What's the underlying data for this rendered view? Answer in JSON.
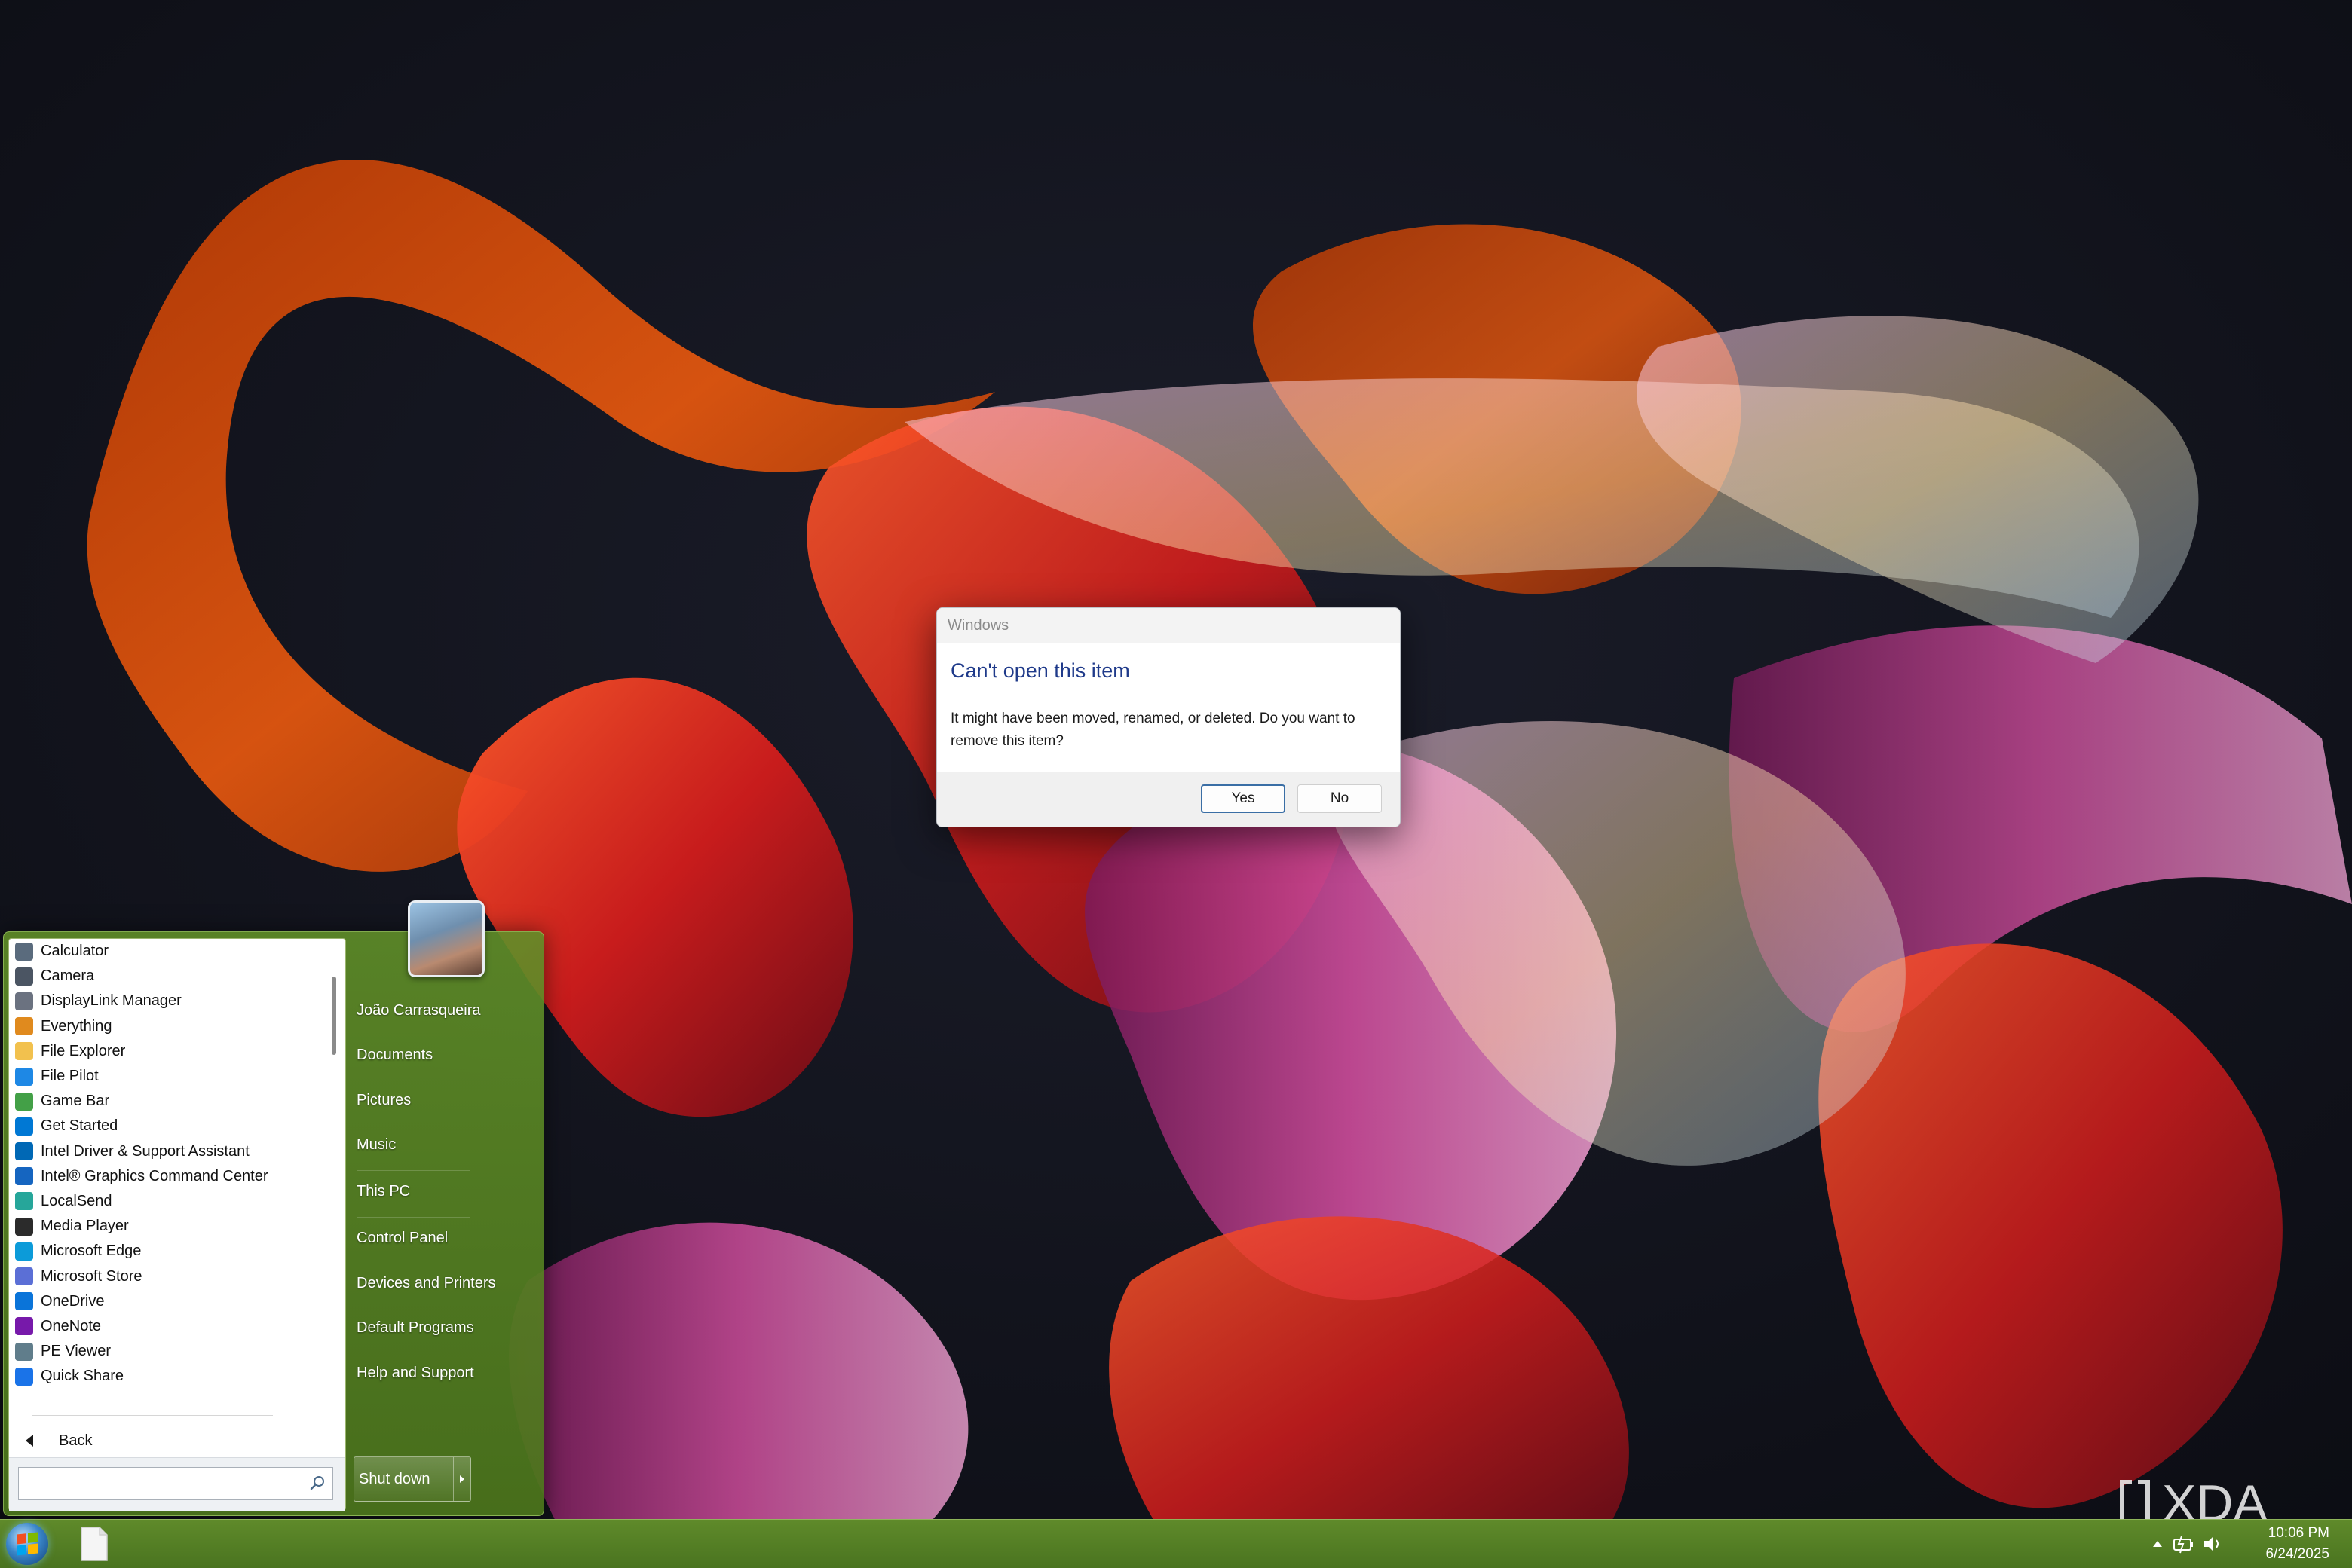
{
  "dialog": {
    "title": "Windows",
    "heading": "Can't open this item",
    "message": "It might have been moved, renamed, or deleted. Do you want to remove this item?",
    "yes_label": "Yes",
    "no_label": "No"
  },
  "start_menu": {
    "programs": [
      {
        "label": "Calculator",
        "icon": "calculator-icon",
        "color": "#5a6b7d"
      },
      {
        "label": "Camera",
        "icon": "camera-icon",
        "color": "#4b5563"
      },
      {
        "label": "DisplayLink Manager",
        "icon": "displaylink-icon",
        "color": "#6b7280"
      },
      {
        "label": "Everything",
        "icon": "everything-icon",
        "color": "#e08a1e"
      },
      {
        "label": "File Explorer",
        "icon": "folder-icon",
        "color": "#f2c14e"
      },
      {
        "label": "File Pilot",
        "icon": "file-pilot-icon",
        "color": "#1e88e5"
      },
      {
        "label": "Game Bar",
        "icon": "game-bar-icon",
        "color": "#43a047"
      },
      {
        "label": "Get Started",
        "icon": "get-started-icon",
        "color": "#0078d4"
      },
      {
        "label": "Intel Driver & Support Assistant",
        "icon": "intel-dsa-icon",
        "color": "#0068b5"
      },
      {
        "label": "Intel® Graphics Command Center",
        "icon": "intel-graphics-icon",
        "color": "#1565c0"
      },
      {
        "label": "LocalSend",
        "icon": "localsend-icon",
        "color": "#26a69a"
      },
      {
        "label": "Media Player",
        "icon": "media-player-icon",
        "color": "#2b2b2b"
      },
      {
        "label": "Microsoft Edge",
        "icon": "edge-icon",
        "color": "#0c9bd9"
      },
      {
        "label": "Microsoft Store",
        "icon": "store-icon",
        "color": "#5b6fd6"
      },
      {
        "label": "OneDrive",
        "icon": "onedrive-icon",
        "color": "#0a74d9"
      },
      {
        "label": "OneNote",
        "icon": "onenote-icon",
        "color": "#7719aa"
      },
      {
        "label": "PE Viewer",
        "icon": "pe-viewer-icon",
        "color": "#607d8b"
      },
      {
        "label": "Quick Share",
        "icon": "quick-share-icon",
        "color": "#1a73e8"
      }
    ],
    "back_label": "Back",
    "search_placeholder": "",
    "user_name": "João Carrasqueira",
    "right_items": [
      "Documents",
      "Pictures",
      "Music",
      "This PC",
      "Control Panel",
      "Devices and Printers",
      "Default Programs",
      "Help and Support"
    ],
    "shutdown_label": "Shut down"
  },
  "taskbar": {
    "time": "10:06 PM",
    "date": "6/24/2025"
  },
  "watermark": "XDA",
  "colors": {
    "start_menu_green": "#5f8a2a",
    "dialog_heading": "#1f3a8a",
    "desktop_bg": "#12131c"
  }
}
